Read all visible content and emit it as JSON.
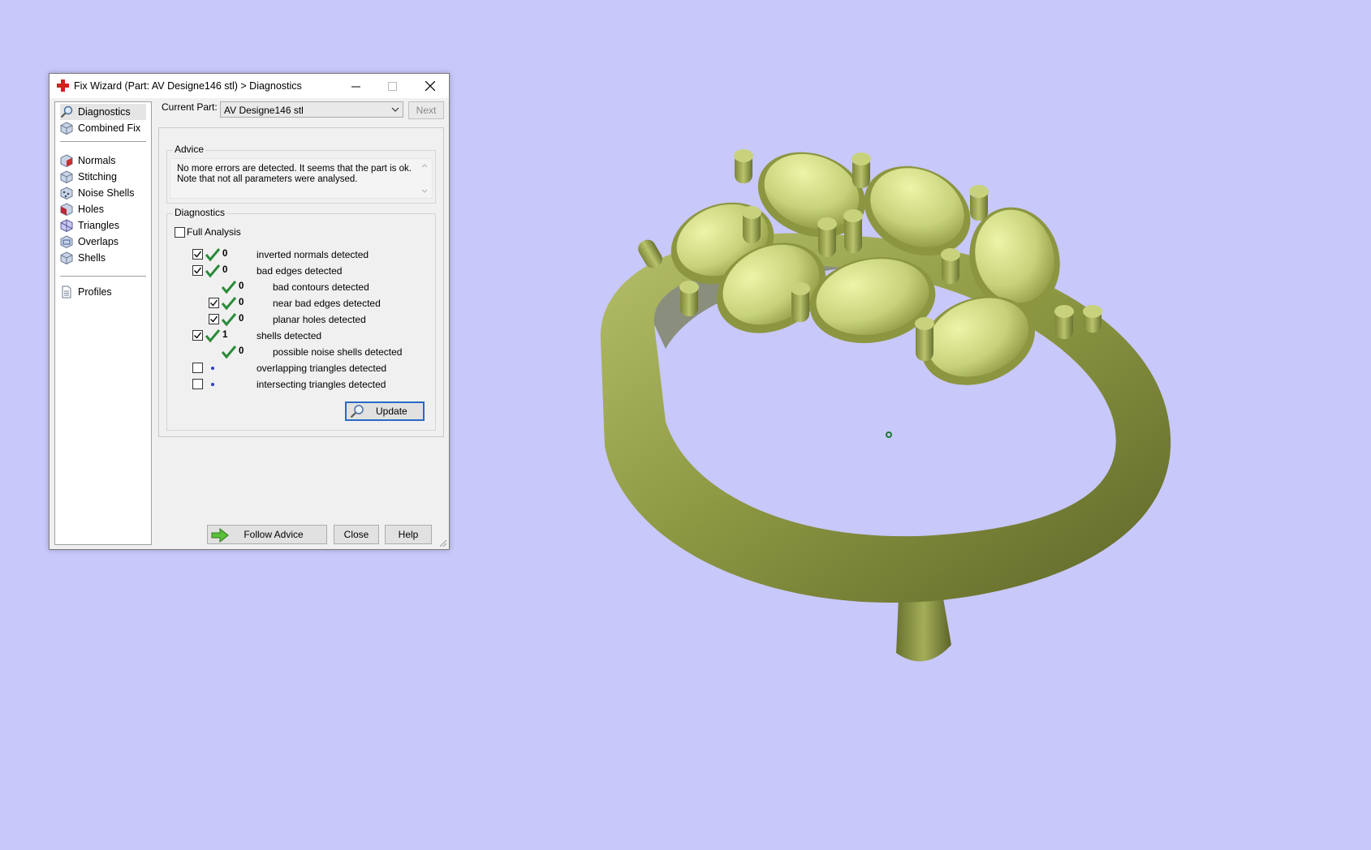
{
  "window": {
    "title": "Fix Wizard (Part: AV Designe146 stl) > Diagnostics",
    "minimize_glyph": "–",
    "close_glyph": "✕"
  },
  "sidebar": {
    "items": [
      {
        "label": "Diagnostics",
        "icon": "magnifier-icon",
        "selected": true
      },
      {
        "label": "Combined Fix",
        "icon": "cube-icon"
      },
      {
        "label": "Normals",
        "icon": "normals-cube-icon"
      },
      {
        "label": "Stitching",
        "icon": "stitching-cube-icon"
      },
      {
        "label": "Noise Shells",
        "icon": "noise-shells-icon"
      },
      {
        "label": "Holes",
        "icon": "holes-cube-icon"
      },
      {
        "label": "Triangles",
        "icon": "triangles-cube-icon"
      },
      {
        "label": "Overlaps",
        "icon": "overlaps-cube-icon"
      },
      {
        "label": "Shells",
        "icon": "shells-cube-icon"
      }
    ],
    "profiles_label": "Profiles"
  },
  "current_part": {
    "label": "Current Part:",
    "value": "AV Designe146 stl",
    "next_label": "Next"
  },
  "advice": {
    "legend": "Advice",
    "text": "No more errors are detected. It seems that the part is ok. Note that not all parameters were analysed."
  },
  "diagnostics": {
    "legend": "Diagnostics",
    "full_analysis_label": "Full Analysis",
    "full_analysis_checked": false,
    "rows": [
      {
        "checkbox": true,
        "checked": true,
        "status": "ok",
        "count": "0",
        "label": "inverted normals detected",
        "indent": 0
      },
      {
        "checkbox": true,
        "checked": true,
        "status": "ok",
        "count": "0",
        "label": "bad edges detected",
        "indent": 0
      },
      {
        "checkbox": false,
        "checked": false,
        "status": "ok",
        "count": "0",
        "label": "bad contours detected",
        "indent": 1
      },
      {
        "checkbox": true,
        "checked": true,
        "status": "ok",
        "count": "0",
        "label": "near bad edges detected",
        "indent": 1
      },
      {
        "checkbox": true,
        "checked": true,
        "status": "ok",
        "count": "0",
        "label": "planar holes detected",
        "indent": 1
      },
      {
        "checkbox": true,
        "checked": true,
        "status": "ok",
        "count": "1",
        "label": "shells detected",
        "indent": 0
      },
      {
        "checkbox": false,
        "checked": false,
        "status": "ok",
        "count": "0",
        "label": "possible noise shells detected",
        "indent": 1
      },
      {
        "checkbox": true,
        "checked": false,
        "status": "dot",
        "count": "",
        "label": "overlapping triangles detected",
        "indent": 0
      },
      {
        "checkbox": true,
        "checked": false,
        "status": "dot",
        "count": "",
        "label": "intersecting triangles detected",
        "indent": 0
      }
    ],
    "update_label": "Update"
  },
  "footer": {
    "follow_label": "Follow Advice",
    "close_label": "Close",
    "help_label": "Help"
  },
  "colors": {
    "background": "#c8c8fa",
    "model": "#9aa452",
    "ok_check": "#2a8a3a",
    "accent": "#2a69c8"
  }
}
